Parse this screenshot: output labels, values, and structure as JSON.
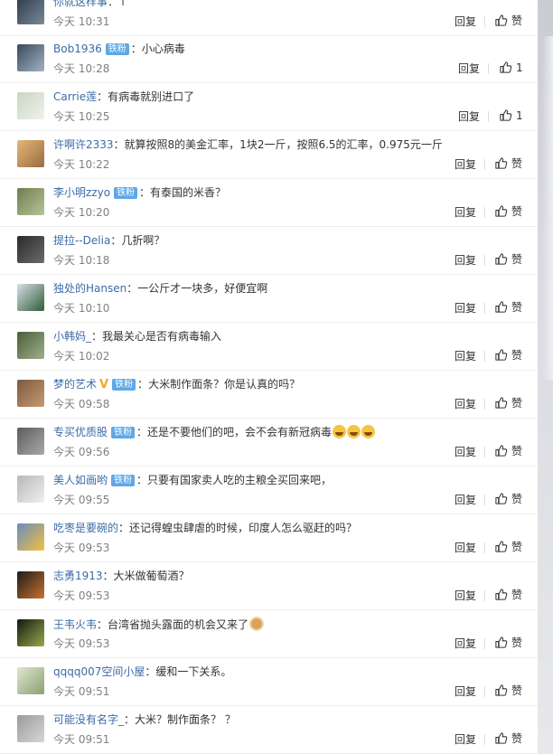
{
  "colors": {
    "username": "#3c6ba8",
    "badge_bg": "#5ea8e6",
    "time": "#808080",
    "text": "#333333"
  },
  "actions": {
    "reply_label": "回复",
    "like_label": "赞"
  },
  "comments": [
    {
      "user": "你就这样事",
      "badge": "",
      "text": "：↑",
      "time": "今天 10:31",
      "likes": "赞"
    },
    {
      "user": "Bob1936",
      "badge": "铁粉",
      "text": "：小心病毒",
      "time": "今天 10:28",
      "likes": "1"
    },
    {
      "user": "Carrie莲",
      "badge": "",
      "text": "：有病毒就别进口了",
      "time": "今天 10:25",
      "likes": "1"
    },
    {
      "user": "许啊许2333",
      "badge": "",
      "text": "：就算按照8的美金汇率，1块2一斤，按照6.5的汇率，0.975元一斤",
      "time": "今天 10:22",
      "likes": "赞"
    },
    {
      "user": "李小明zzyo",
      "badge": "铁粉",
      "text": "：有泰国的米香？",
      "time": "今天 10:20",
      "likes": "赞"
    },
    {
      "user": "提拉--Delia",
      "badge": "",
      "text": "：几折啊？",
      "time": "今天 10:18",
      "likes": "赞"
    },
    {
      "user": "独处的Hansen",
      "badge": "",
      "text": "：一公斤才一块多，好便宜啊",
      "time": "今天 10:10",
      "likes": "赞"
    },
    {
      "user": "小韩妈_",
      "badge": "",
      "text": "：我最关心是否有病毒输入",
      "time": "今天 10:02",
      "likes": "赞"
    },
    {
      "user": "梦的艺术",
      "badge": "铁粉",
      "verified": "V",
      "text": "：大米制作面条？你是认真的吗？",
      "time": "今天 09:58",
      "likes": "赞"
    },
    {
      "user": "专买优质股",
      "badge": "铁粉",
      "text": "：还是不要他们的吧，会不会有新冠病毒",
      "emoji_count": 3,
      "time": "今天 09:56",
      "likes": "赞"
    },
    {
      "user": "美人如画哟",
      "badge": "铁粉",
      "text": "：只要有国家卖人吃的主粮全买回来吧，",
      "time": "今天 09:55",
      "likes": "赞"
    },
    {
      "user": "吃枣是要碗的",
      "badge": "",
      "text": "：还记得蝗虫肆虐的时候，印度人怎么驱赶的吗？",
      "time": "今天 09:53",
      "likes": "赞"
    },
    {
      "user": "志勇1913",
      "badge": "",
      "text": "：大米做葡萄酒？",
      "time": "今天 09:53",
      "likes": "赞"
    },
    {
      "user": "王韦火韦",
      "badge": "",
      "text": "：台湾省抛头露面的机会又来了",
      "cat_emoji": true,
      "time": "今天 09:53",
      "likes": "赞"
    },
    {
      "user": "qqqq007空间小屋",
      "badge": "",
      "text": "：缓和一下关系。",
      "time": "今天 09:51",
      "likes": "赞"
    },
    {
      "user": "可能没有名字_",
      "badge": "",
      "text": "：大米？制作面条？ ？",
      "time": "今天 09:51",
      "likes": "赞"
    }
  ]
}
